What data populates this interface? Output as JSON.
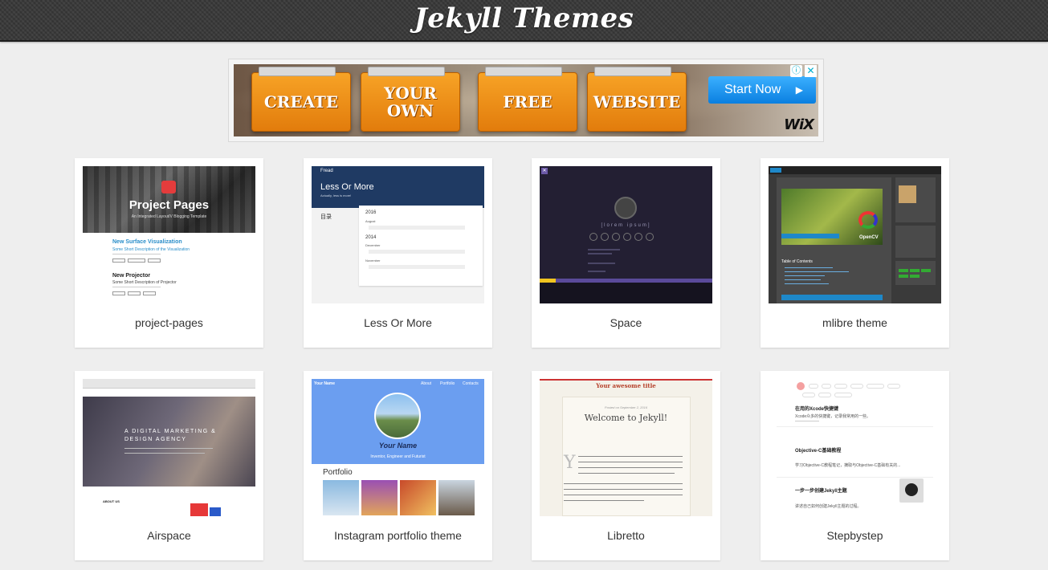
{
  "header": {
    "title": "Jekyll Themes"
  },
  "ad": {
    "folders": [
      {
        "line1": "CREATE",
        "line2": ""
      },
      {
        "line1": "YOUR",
        "line2": "OWN"
      },
      {
        "line1": "FREE",
        "line2": ""
      },
      {
        "line1": "WEBSITE",
        "line2": ""
      }
    ],
    "cta": "Start Now",
    "brand": "WiX",
    "info_icon": "info-icon",
    "close_icon": "close-icon"
  },
  "themes": [
    {
      "name": "project-pages",
      "preview": {
        "banner": "Project Pages",
        "banner_sub": "An Integrated Layout/V Blogging Template",
        "post1_title": "New Surface Visualization",
        "post1_sub": "Some Short Description of the Visualization",
        "post2_title": "New Projector",
        "post2_sub": "Some Short Description of Projector"
      }
    },
    {
      "name": "Less Or More",
      "preview": {
        "nav_brand": "Fread",
        "hero_title": "Less Or More",
        "hero_sub": "Actually, less is more!",
        "toc_label": "目录",
        "years": [
          "2016",
          "2014"
        ],
        "months": [
          "August",
          "December",
          "November"
        ]
      }
    },
    {
      "name": "Space",
      "preview": {
        "tagline": "[lorem ipsum]"
      }
    },
    {
      "name": "mlibre theme",
      "preview": {
        "badge": "OpenCV",
        "toc_title": "Table of Contents"
      }
    },
    {
      "name": "Airspace",
      "preview": {
        "hero_line1": "A DIGITAL MARKETING &",
        "hero_line2": "DESIGN AGENCY",
        "section": "ABOUT US"
      }
    },
    {
      "name": "Instagram portfolio theme",
      "preview": {
        "nav_brand": "Your Name",
        "nav_links": [
          "About",
          "Portfolio",
          "Contacts"
        ],
        "hero_name": "Your Name",
        "hero_sub": "Inventor, Engineer and Futurist",
        "section": "Portfolio"
      }
    },
    {
      "name": "Libretto",
      "preview": {
        "site_title": "Your awesome title",
        "post_date": "Posted on September 2, 2016",
        "post_title": "Welcome to Jekyll!"
      }
    },
    {
      "name": "Stepbystep",
      "preview": {
        "post1": "在用的Xcode快捷键",
        "post1_sub": "Xcode众多的快捷键，记录我常用的一些。",
        "post2": "Objective-C基础教程",
        "post2_sub": "学习Objective-C教程笔记，摘取与Objective-C基础有关的...",
        "post3": "一步一步创建Jekyll主题",
        "post3_sub": "讲述自己如何创建Jekyll主题的过程。"
      }
    }
  ],
  "colors": {
    "header_bg": "#3a3a3a",
    "page_bg": "#eeeeee",
    "ad_orange": "#f7a326",
    "ad_cta": "#0a7fe0"
  }
}
